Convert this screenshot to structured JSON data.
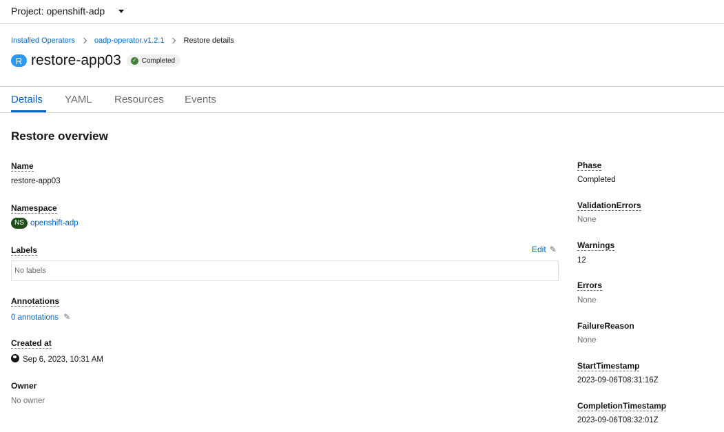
{
  "project": {
    "label": "Project: openshift-adp"
  },
  "breadcrumb": {
    "items": [
      "Installed Operators",
      "oadp-operator.v1.2.1",
      "Restore details"
    ]
  },
  "resource": {
    "badge": "R",
    "name": "restore-app03",
    "status": "Completed"
  },
  "tabs": [
    "Details",
    "YAML",
    "Resources",
    "Events"
  ],
  "section_title": "Restore overview",
  "left": {
    "name_label": "Name",
    "name_value": "restore-app03",
    "namespace_label": "Namespace",
    "namespace_badge": "NS",
    "namespace_value": "openshift-adp",
    "labels_label": "Labels",
    "labels_edit": "Edit",
    "labels_value": "No labels",
    "annotations_label": "Annotations",
    "annotations_value": "0 annotations",
    "created_label": "Created at",
    "created_value": "Sep 6, 2023, 10:31 AM",
    "owner_label": "Owner",
    "owner_value": "No owner"
  },
  "right": {
    "phase_label": "Phase",
    "phase_value": "Completed",
    "validation_label": "ValidationErrors",
    "validation_value": "None",
    "warnings_label": "Warnings",
    "warnings_value": "12",
    "errors_label": "Errors",
    "errors_value": "None",
    "failure_label": "FailureReason",
    "failure_value": "None",
    "start_label": "StartTimestamp",
    "start_value": "2023-09-06T08:31:16Z",
    "completion_label": "CompletionTimestamp",
    "completion_value": "2023-09-06T08:32:01Z"
  },
  "colors": {
    "link": "#0066cc",
    "resource_badge": "#2b9af3",
    "namespace_badge": "#1e4f18",
    "status_success": "#3e8635"
  },
  "icons": [
    "caret-down-icon",
    "chevron-right-icon",
    "check-circle-icon",
    "pencil-icon",
    "globe-icon"
  ]
}
